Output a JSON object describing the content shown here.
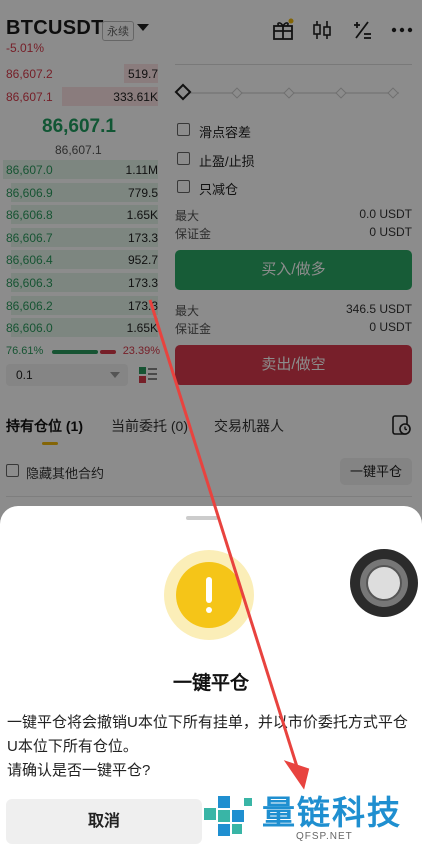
{
  "header": {
    "symbol": "BTCUSDT",
    "contract_type": "永续",
    "change": "-5.01%"
  },
  "orderbook": {
    "asks": [
      {
        "price": "86,607.2",
        "qty": "519.7",
        "depth": 0.22
      },
      {
        "price": "86,607.1",
        "qty": "333.61K",
        "depth": 0.62
      }
    ],
    "last_price": "86,607.1",
    "mark_price": "86,607.1",
    "bids": [
      {
        "price": "86,607.0",
        "qty": "1.11M",
        "depth": 1.0
      },
      {
        "price": "86,606.9",
        "qty": "779.5",
        "depth": 0.95
      },
      {
        "price": "86,606.8",
        "qty": "1.65K",
        "depth": 0.95
      },
      {
        "price": "86,606.7",
        "qty": "173.3",
        "depth": 0.95
      },
      {
        "price": "86,606.4",
        "qty": "952.7",
        "depth": 0.95
      },
      {
        "price": "86,606.3",
        "qty": "173.3",
        "depth": 0.95
      },
      {
        "price": "86,606.2",
        "qty": "173.3",
        "depth": 0.95
      },
      {
        "price": "86,606.0",
        "qty": "1.65K",
        "depth": 0.95
      }
    ],
    "buy_ratio": "76.61%",
    "sell_ratio": "23.39%",
    "precision": "0.1"
  },
  "form": {
    "opt_slippage": "滑点容差",
    "opt_tpsl": "止盈/止损",
    "opt_reduce_only": "只减仓",
    "buy": {
      "max_label": "最大",
      "max_value": "0.0 USDT",
      "margin_label": "保证金",
      "margin_value": "0 USDT",
      "button": "买入/做多"
    },
    "sell": {
      "max_label": "最大",
      "max_value": "346.5 USDT",
      "margin_label": "保证金",
      "margin_value": "0 USDT",
      "button": "卖出/做空"
    }
  },
  "tabs": {
    "positions": "持有仓位 (1)",
    "orders": "当前委托 (0)",
    "bots": "交易机器人"
  },
  "positions": {
    "hide_others": "隐藏其他合约",
    "close_all": "一键平仓"
  },
  "dialog": {
    "title": "一键平仓",
    "message_line1": "一键平仓将会撤销U本位下所有挂单，并以市价委托方式平仓U本位下所有仓位。",
    "message_line2": "请确认是否一键平仓?",
    "cancel": "取消"
  },
  "watermark": {
    "text": "量链科技",
    "sub": "QFSP.NET"
  },
  "colors": {
    "buy": "#2aa865",
    "sell": "#d93a4d",
    "warning": "#f5c518",
    "annotation_arrow": "#e8433f"
  }
}
